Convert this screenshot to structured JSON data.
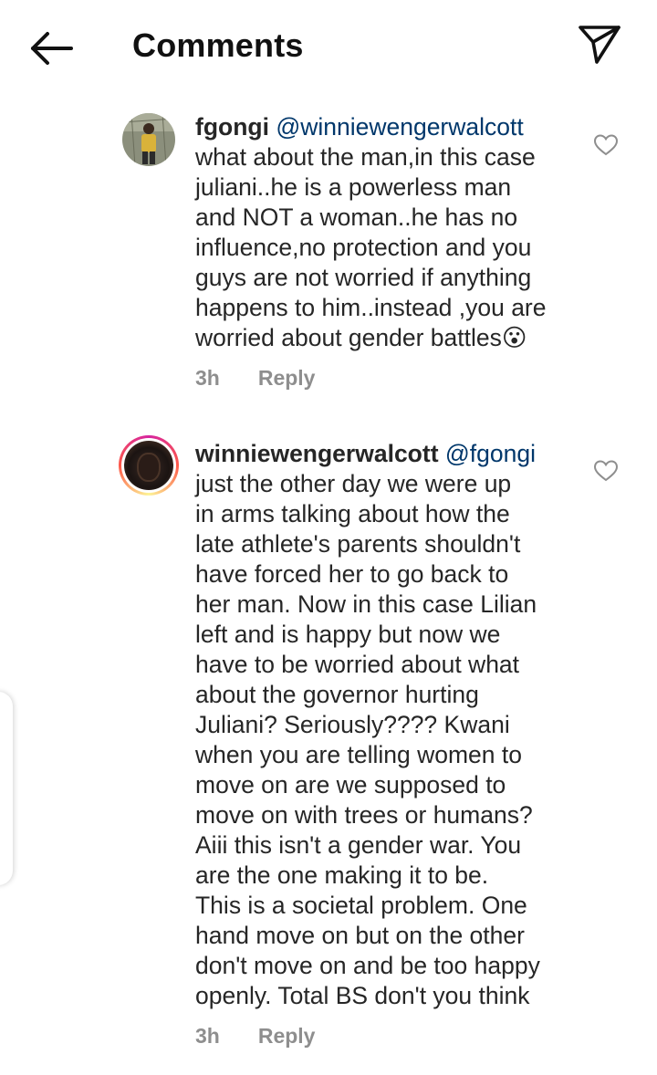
{
  "header": {
    "title": "Comments",
    "back_icon": "arrow-left-icon",
    "share_icon": "direct-send-icon"
  },
  "comments": [
    {
      "username": "fgongi",
      "mention": "@winniewengerwalcott",
      "lines": [
        "what about the man,in this case",
        "juliani..he is a powerless man",
        "and NOT a woman..he has no",
        "influence,no protection and you",
        "guys are not worried if anything",
        "happens to him..instead ,you are",
        "worried about  gender battles"
      ],
      "emoji": "😮",
      "time": "3h",
      "reply_label": "Reply"
    },
    {
      "username": "winniewengerwalcott",
      "mention": "@fgongi",
      "lines": [
        "just the other day we were up",
        "in arms talking about how the",
        "late athlete's parents shouldn't",
        "have forced her to go back to",
        "her man. Now in this case Lilian",
        "left and is happy but now we",
        "have to be worried about what",
        "about the governor hurting",
        "Juliani? Seriously???? Kwani",
        "when you are telling women to",
        "move on are we supposed to",
        "move on with trees or humans?",
        "Aiii this isn't a gender war. You",
        "are the one making it to be.",
        "This is a societal problem. One",
        "hand move on but on the other",
        "don't move on and be too happy",
        "openly. Total BS don't you think"
      ],
      "time": "3h",
      "reply_label": "Reply"
    }
  ]
}
